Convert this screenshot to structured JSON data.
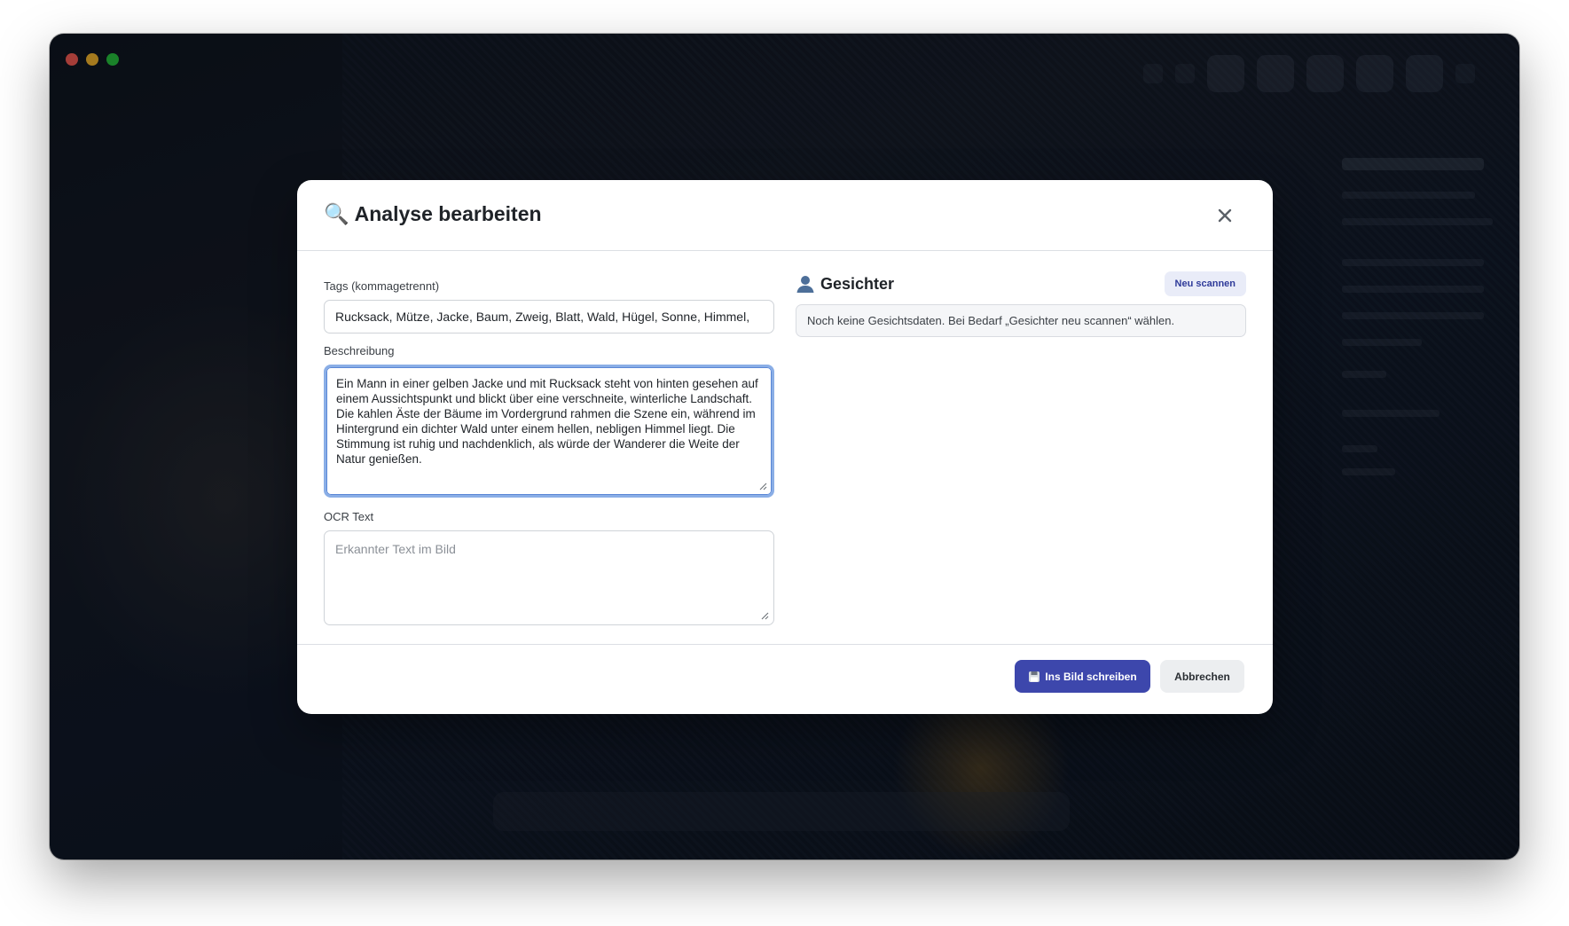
{
  "dialog": {
    "title": "Analyse bearbeiten",
    "title_icon": "magnifier-icon",
    "close_icon": "close-icon"
  },
  "form": {
    "tags_label": "Tags (kommagetrennt)",
    "tags_value": "Rucksack, Mütze, Jacke, Baum, Zweig, Blatt, Wald, Hügel, Sonne, Himmel,",
    "description_label": "Beschreibung",
    "description_value": "Ein Mann in einer gelben Jacke und mit Rucksack steht von hinten gesehen auf einem Aussichtspunkt und blickt über eine verschneite, winterliche Landschaft. Die kahlen Äste der Bäume im Vordergrund rahmen die Szene ein, während im Hintergrund ein dichter Wald unter einem hellen, nebligen Himmel liegt. Die Stimmung ist ruhig und nachdenklich, als würde der Wanderer die Weite der Natur genießen.",
    "ocr_label": "OCR Text",
    "ocr_placeholder": "Erkannter Text im Bild"
  },
  "faces": {
    "title": "Gesichter",
    "rescan_label": "Neu scannen",
    "info_text": "Noch keine Gesichtsdaten. Bei Bedarf „Gesichter neu scannen“ wählen."
  },
  "footer": {
    "save_label": "Ins Bild schreiben",
    "cancel_label": "Abbrechen"
  },
  "colors": {
    "primary": "#3d47ac",
    "focus_ring": "#8aaee6",
    "rescan_bg": "#e9ecf8"
  }
}
